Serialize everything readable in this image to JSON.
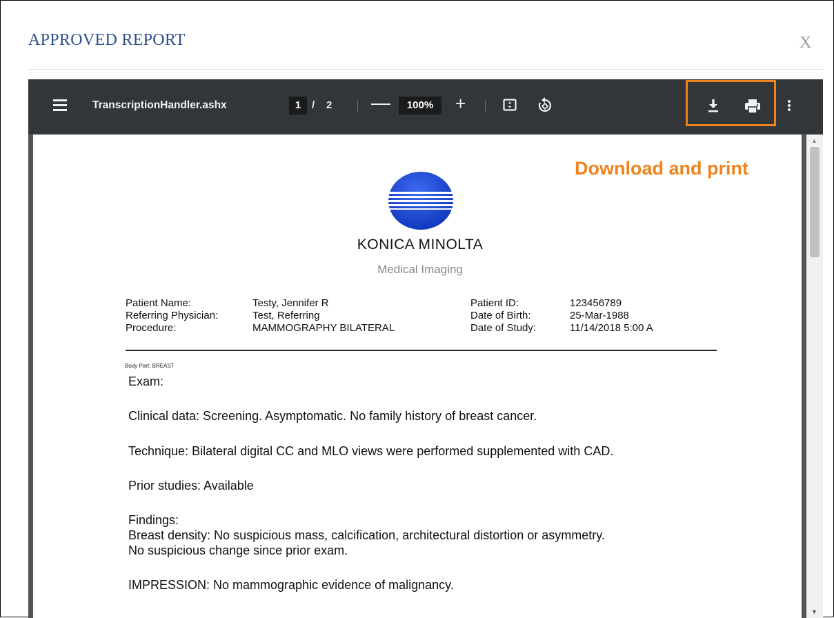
{
  "modal": {
    "title": "APPROVED REPORT",
    "close_label": "X"
  },
  "viewer": {
    "filename": "TranscriptionHandler.ashx",
    "current_page": "1",
    "page_separator": "/",
    "total_pages": "2",
    "zoom_minus": "—",
    "zoom_level": "100%",
    "zoom_plus": "+",
    "icons": [
      "menu-icon",
      "fit-to-page-icon",
      "rotate-icon",
      "download-icon",
      "print-icon",
      "more-options-icon"
    ]
  },
  "annotation": {
    "text": "Download and print",
    "color": "#f0831e"
  },
  "report": {
    "brand": "KONICA MINOLTA",
    "brand_sub": "Medical Imaging",
    "patient_info": {
      "patient_name_label": "Patient Name:",
      "patient_name": "Testy, Jennifer R",
      "referring_label": "Referring Physician:",
      "referring": "Test, Referring",
      "procedure_label": "Procedure:",
      "procedure": "MAMMOGRAPHY BILATERAL",
      "patient_id_label": "Patient ID:",
      "patient_id": "123456789",
      "dob_label": "Date of Birth:",
      "dob": "25-Mar-1988",
      "study_date_label": "Date of Study:",
      "study_date": "11/14/2018 5:00 A"
    },
    "body_part": "Body Part: BREAST",
    "exam": "Exam:",
    "clinical": "Clinical data: Screening. Asymptomatic. No family history of breast cancer.",
    "technique": "Technique: Bilateral digital CC and MLO views were performed supplemented with CAD.",
    "prior": "Prior studies: Available",
    "findings_heading": "Findings:",
    "findings_line1": "Breast density: No suspicious mass, calcification, architectural distortion or asymmetry.",
    "findings_line2": "No suspicious change since prior exam.",
    "impression": "IMPRESSION: No mammographic evidence of malignancy."
  },
  "colors": {
    "title_blue": "#2d4f8a",
    "toolbar": "#323639",
    "viewer_bg": "#525659",
    "highlight": "#f0831e",
    "logo_blue": "#1640c8"
  }
}
